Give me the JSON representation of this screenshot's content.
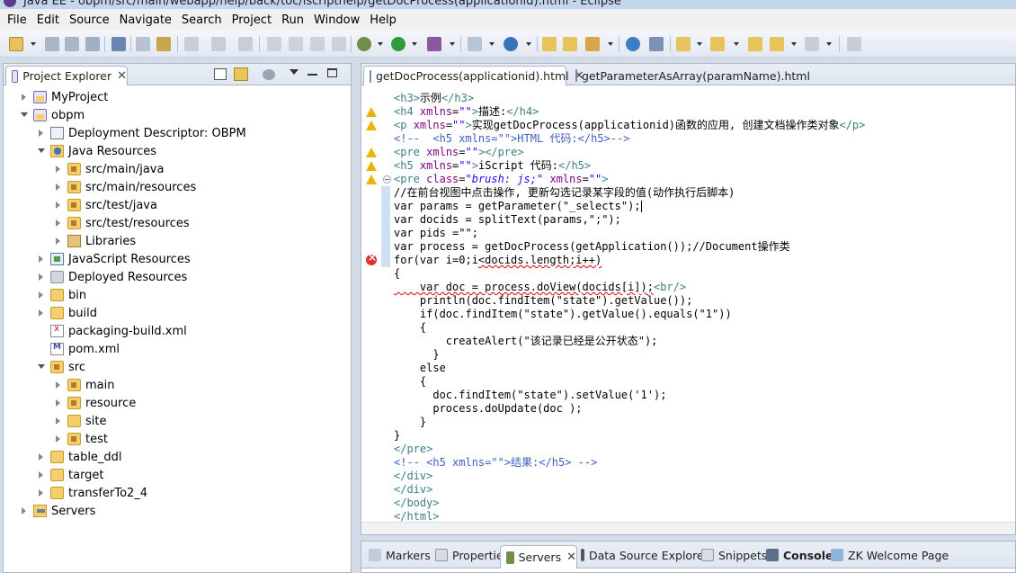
{
  "window": {
    "title": "Java EE - obpm/src/main/webapp/help/back/toc/iscripthelp/getDocProcess(applicationid).html - Eclipse"
  },
  "menu": [
    "File",
    "Edit",
    "Source",
    "Navigate",
    "Search",
    "Project",
    "Run",
    "Window",
    "Help"
  ],
  "project_explorer": {
    "tab_label": "Project Explorer",
    "tree": [
      {
        "label": "MyProject",
        "icon": "project-icon",
        "state": "closed",
        "depth": 0
      },
      {
        "label": "obpm",
        "icon": "project-icon",
        "state": "open",
        "depth": 0
      },
      {
        "label": "Deployment Descriptor: OBPM",
        "icon": "descriptor-icon",
        "state": "closed",
        "depth": 1
      },
      {
        "label": "Java Resources",
        "icon": "java-resources-icon",
        "state": "open",
        "depth": 1
      },
      {
        "label": "src/main/java",
        "icon": "source-folder-icon",
        "state": "closed",
        "depth": 2
      },
      {
        "label": "src/main/resources",
        "icon": "source-folder-icon",
        "state": "closed",
        "depth": 2
      },
      {
        "label": "src/test/java",
        "icon": "source-folder-icon",
        "state": "closed",
        "depth": 2
      },
      {
        "label": "src/test/resources",
        "icon": "source-folder-icon",
        "state": "closed",
        "depth": 2
      },
      {
        "label": "Libraries",
        "icon": "library-icon",
        "state": "closed",
        "depth": 2
      },
      {
        "label": "JavaScript Resources",
        "icon": "javascript-icon",
        "state": "closed",
        "depth": 1
      },
      {
        "label": "Deployed Resources",
        "icon": "deployed-icon",
        "state": "closed",
        "depth": 1
      },
      {
        "label": "bin",
        "icon": "folder-icon",
        "state": "closed",
        "depth": 1
      },
      {
        "label": "build",
        "icon": "folder-icon",
        "state": "closed",
        "depth": 1
      },
      {
        "label": "packaging-build.xml",
        "icon": "xml-file-icon",
        "state": "none",
        "depth": 1
      },
      {
        "label": "pom.xml",
        "icon": "pom-file-icon",
        "state": "none",
        "depth": 1
      },
      {
        "label": "src",
        "icon": "package-folder-icon",
        "state": "open",
        "depth": 1
      },
      {
        "label": "main",
        "icon": "package-folder-icon",
        "state": "closed",
        "depth": 2
      },
      {
        "label": "resource",
        "icon": "package-folder-icon",
        "state": "closed",
        "depth": 2
      },
      {
        "label": "site",
        "icon": "folder-icon",
        "state": "closed",
        "depth": 2
      },
      {
        "label": "test",
        "icon": "package-folder-icon",
        "state": "closed",
        "depth": 2
      },
      {
        "label": "table_ddl",
        "icon": "folder-icon",
        "state": "closed",
        "depth": 1
      },
      {
        "label": "target",
        "icon": "folder-icon",
        "state": "closed",
        "depth": 1
      },
      {
        "label": "transferTo2_4",
        "icon": "folder-icon",
        "state": "closed",
        "depth": 1
      },
      {
        "label": "Servers",
        "icon": "servers-folder-icon",
        "state": "closed",
        "depth": 0
      }
    ]
  },
  "editor": {
    "tabs": [
      {
        "label": "getDocProcess(applicationid).html",
        "active": true
      },
      {
        "label": "getParameterAsArray(paramName).html",
        "active": false
      }
    ],
    "lines": [
      {
        "text": "<h3>示例</h3>",
        "marker": "none",
        "type": "tag"
      },
      {
        "text": "<h4 xmlns=\"\">描述:</h4>",
        "marker": "warning",
        "type": "tag"
      },
      {
        "text": "<p xmlns=\"\">实现getDocProcess(applicationid)函数的应用, 创建文档操作类对象</p>",
        "marker": "warning",
        "type": "tag"
      },
      {
        "text": "<!--  <h5 xmlns=\"\">HTML 代码:</h5>-->",
        "marker": "none",
        "type": "comment"
      },
      {
        "text": "<pre xmlns=\"\"></pre>",
        "marker": "warning",
        "type": "tag"
      },
      {
        "text": "<h5 xmlns=\"\">iScript 代码:</h5>",
        "marker": "warning",
        "type": "tag"
      },
      {
        "text": "<pre class=\"brush: js;\" xmlns=\"\">",
        "marker": "warning",
        "type": "tag"
      },
      {
        "text": "//在前台视图中点击操作, 更新勾选记录某字段的值(动作执行后脚本)",
        "marker": "none",
        "type": "plain"
      },
      {
        "text": "var params = getParameter(\"_selects\");",
        "marker": "none",
        "type": "plain"
      },
      {
        "text": "var docids = splitText(params,\";\");",
        "marker": "none",
        "type": "plain"
      },
      {
        "text": "var pids =\"\";",
        "marker": "none",
        "type": "plain"
      },
      {
        "text": "var process = getDocProcess(getApplication());//Document操作类",
        "marker": "none",
        "type": "plain"
      },
      {
        "text": "for(var i=0;i<docids.length;i++)",
        "marker": "error",
        "type": "plain"
      },
      {
        "text": "{",
        "marker": "none",
        "type": "plain"
      },
      {
        "text": "    var doc = process.doView(docids[i]);<br/>",
        "marker": "none",
        "type": "plain"
      },
      {
        "text": "    println(doc.findItem(\"state\").getValue());",
        "marker": "none",
        "type": "plain"
      },
      {
        "text": "    if(doc.findItem(\"state\").getValue().equals(\"1\"))",
        "marker": "none",
        "type": "plain"
      },
      {
        "text": "    {",
        "marker": "none",
        "type": "plain"
      },
      {
        "text": "        createAlert(\"该记录已经是公开状态\");",
        "marker": "none",
        "type": "plain"
      },
      {
        "text": "      }",
        "marker": "none",
        "type": "plain"
      },
      {
        "text": "    else",
        "marker": "none",
        "type": "plain"
      },
      {
        "text": "    {",
        "marker": "none",
        "type": "plain"
      },
      {
        "text": "      doc.findItem(\"state\").setValue('1');",
        "marker": "none",
        "type": "plain"
      },
      {
        "text": "      process.doUpdate(doc );",
        "marker": "none",
        "type": "plain"
      },
      {
        "text": "    }",
        "marker": "none",
        "type": "plain"
      },
      {
        "text": "}",
        "marker": "none",
        "type": "plain"
      },
      {
        "text": "</pre>",
        "marker": "none",
        "type": "tag"
      },
      {
        "text": "<!-- <h5 xmlns=\"\">结果:</h5> -->",
        "marker": "none",
        "type": "comment"
      },
      {
        "text": "</div>",
        "marker": "none",
        "type": "tag"
      },
      {
        "text": "</div>",
        "marker": "none",
        "type": "tag"
      },
      {
        "text": "</body>",
        "marker": "none",
        "type": "tag"
      },
      {
        "text": "</html>",
        "marker": "none",
        "type": "tag"
      }
    ]
  },
  "bottom_panel": {
    "tabs": [
      {
        "label": "Markers",
        "active": false,
        "icon": "markers-icon"
      },
      {
        "label": "Properties",
        "active": false,
        "icon": "properties-icon"
      },
      {
        "label": "Servers",
        "active": true,
        "icon": "servers-icon"
      },
      {
        "label": "Data Source Explorer",
        "active": false,
        "icon": "data-source-icon"
      },
      {
        "label": "Snippets",
        "active": false,
        "icon": "snippets-icon"
      },
      {
        "label": "Console",
        "active": false,
        "icon": "console-icon"
      },
      {
        "label": "ZK Welcome Page",
        "active": false,
        "icon": "zk-icon"
      }
    ]
  },
  "colors": {
    "tag": "#3f7f7f",
    "attr": "#7f007f",
    "attr_value": "#2a00ff",
    "comment": "#3f5fbf",
    "warning": "#e9b500",
    "error": "#dd3333"
  }
}
